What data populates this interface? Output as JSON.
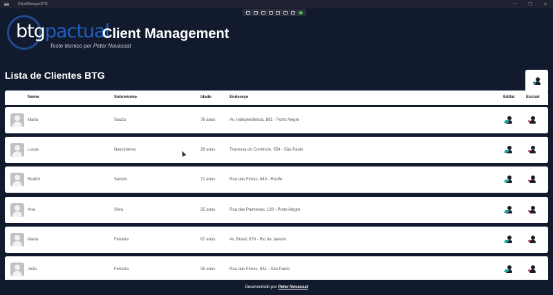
{
  "window": {
    "title": "ClientManagerBTG",
    "controls": [
      "—",
      "❐",
      "✕"
    ]
  },
  "header": {
    "logo_btg": "btg",
    "logo_pactual": "pactual",
    "app_name": "Client Management",
    "subtitle": "Teste técnico por Peter Novassat"
  },
  "list": {
    "title": "Lista de Clientes BTG",
    "columns": {
      "nome": "Nome",
      "sobrenome": "Sobrenome",
      "idade": "Idade",
      "endereco": "Endereço",
      "editar": "Editar",
      "excluir": "Excluir"
    },
    "rows": [
      {
        "nome": "Maria",
        "sobrenome": "Souza",
        "idade": "76 anos",
        "endereco": "Av. Independência, 891 - Porto Alegre"
      },
      {
        "nome": "Lucas",
        "sobrenome": "Nascimento",
        "idade": "28 anos",
        "endereco": "Travessa do Comércio, 554 - São Paulo"
      },
      {
        "nome": "Beatriz",
        "sobrenome": "Santos",
        "idade": "72 anos",
        "endereco": "Rua das Flores, 643 - Recife"
      },
      {
        "nome": "Ana",
        "sobrenome": "Silva",
        "idade": "25 anos",
        "endereco": "Rua das Palmeiras, 130 - Porto Alegre"
      },
      {
        "nome": "Maria",
        "sobrenome": "Ferreira",
        "idade": "67 anos",
        "endereco": "Av. Brasil, 678 - Rio de Janeiro"
      },
      {
        "nome": "João",
        "sobrenome": "Ferreira",
        "idade": "35 anos",
        "endereco": "Rua das Flores, 651 - São Paulo"
      }
    ]
  },
  "footer": {
    "prefix": "Desenvolvido por",
    "author": "Peter Novassat"
  },
  "colors": {
    "background": "#121a2d",
    "brand_blue": "#1f5fbf",
    "edit_accent": "#1aa3a3",
    "delete_accent": "#d6336c"
  },
  "icons": [
    "hamburger-menu-icon",
    "add-person-icon",
    "edit-person-icon",
    "delete-person-icon",
    "avatar-placeholder-icon"
  ]
}
